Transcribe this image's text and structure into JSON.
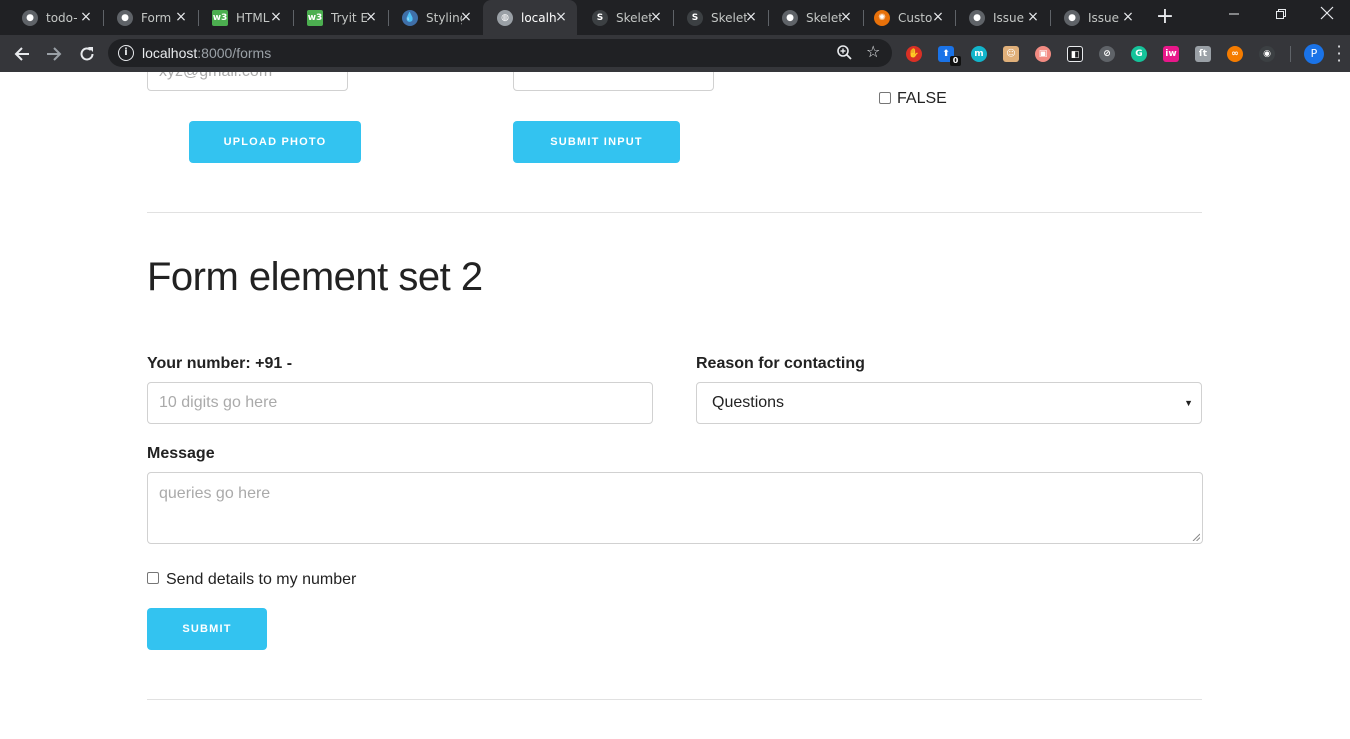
{
  "browser": {
    "tabs": [
      {
        "title": "todo-",
        "icon": "github-icon",
        "active": false
      },
      {
        "title": "Form",
        "icon": "github-icon",
        "active": false
      },
      {
        "title": "HTML",
        "icon": "w3schools-icon",
        "active": false
      },
      {
        "title": "Tryit E",
        "icon": "w3schools-icon",
        "active": false
      },
      {
        "title": "Styling",
        "icon": "drop-icon",
        "active": false
      },
      {
        "title": "localh",
        "icon": "globe-icon",
        "active": true
      },
      {
        "title": "Skelet",
        "icon": "skeleton-s-icon",
        "active": false
      },
      {
        "title": "Skelet",
        "icon": "skeleton-s-icon",
        "active": false
      },
      {
        "title": "Skelet",
        "icon": "github-icon",
        "active": false
      },
      {
        "title": "Custo",
        "icon": "custom-icon",
        "active": false
      },
      {
        "title": "Issue",
        "icon": "github-icon",
        "active": false
      },
      {
        "title": "Issue",
        "icon": "github-icon",
        "active": false
      }
    ],
    "tab_close": "×",
    "new_tab": "+",
    "url_host": "localhost",
    "url_path": ":8000/forms",
    "extension_badge": "0",
    "profile_initial": "P",
    "colors": {
      "tabbar": "#202124",
      "toolbar": "#35363a",
      "accent": "#33c3f0"
    }
  },
  "top_section": {
    "email_placeholder": "xyz@gmail.com",
    "upload_button": "UPLOAD PHOTO",
    "submit_input_button": "SUBMIT INPUT",
    "false_checkbox_label": "FALSE"
  },
  "form_set_2": {
    "heading": "Form element set 2",
    "number_label": "Your number: +91 -",
    "number_placeholder": "10 digits go here",
    "reason_label": "Reason for contacting",
    "reason_selected": "Questions",
    "message_label": "Message",
    "message_placeholder": "queries go here",
    "send_details_label": "Send details to my number",
    "submit_button": "SUBMIT"
  }
}
